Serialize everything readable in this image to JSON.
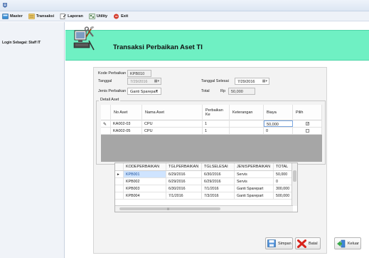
{
  "menu": {
    "items": [
      {
        "label": "Master",
        "icon": "master-icon",
        "color": "#3a8fd6"
      },
      {
        "label": "Transaksi",
        "icon": "transaksi-icon",
        "color": "#e2b23a"
      },
      {
        "label": "Laporan",
        "icon": "laporan-icon",
        "color": "#6a6a6a"
      },
      {
        "label": "Utility",
        "icon": "utility-icon",
        "color": "#4a7c4a"
      },
      {
        "label": "Exit",
        "icon": "exit-icon",
        "color": "#d43a2a"
      }
    ]
  },
  "sidebar": {
    "login_label": "Login Sebagai: Staff IT"
  },
  "header": {
    "title": "Transaksi Perbaikan Aset TI",
    "band_color": "#6ff0c3"
  },
  "form": {
    "kode_label": "Kode Perbaikan",
    "kode_value": "KPB010",
    "tanggal_label": "Tanggal",
    "tanggal_value": "7/29/2016",
    "jenis_label": "Jenis Perbaikan",
    "jenis_value": "Ganti Sparepart",
    "tgl_selesai_label": "Tanggal Selesai",
    "tgl_selesai_value": "7/29/2016",
    "total_label": "Total",
    "total_currency": "Rp",
    "total_value": "50,000"
  },
  "detail": {
    "legend": "Detail Aset",
    "columns": [
      "No Aset",
      "Nama Aset",
      "Perbaikan Ke",
      "Keterangan",
      "Biaya",
      "Pilih"
    ],
    "rows": [
      {
        "marker": "✎",
        "no": "KA002-03",
        "nama": "CPU",
        "ke": "1",
        "ket": "",
        "biaya": "50,000",
        "pilih": true
      },
      {
        "marker": "",
        "no": "KA002-05",
        "nama": "CPU",
        "ke": "1",
        "ket": "",
        "biaya": "0",
        "pilih": false
      }
    ]
  },
  "history": {
    "columns": [
      "KODEPERBAIKAN",
      "TGLPERBAIKAN",
      "TGLSELESAI",
      "JENISPERBAIKAN",
      "TOTAL"
    ],
    "rows": [
      {
        "marker": "▸",
        "kode": "KPB001",
        "tgl": "6/29/2016",
        "selesai": "6/30/2016",
        "jenis": "Servis",
        "total": "50,000"
      },
      {
        "marker": "",
        "kode": "KPB002",
        "tgl": "6/29/2016",
        "selesai": "6/29/2016",
        "jenis": "Servis",
        "total": "0"
      },
      {
        "marker": "",
        "kode": "KPB003",
        "tgl": "6/30/2016",
        "selesai": "7/1/2016",
        "jenis": "Ganti Sparepart",
        "total": "300,000"
      },
      {
        "marker": "",
        "kode": "KPB004",
        "tgl": "7/1/2016",
        "selesai": "7/3/2016",
        "jenis": "Ganti Sparepart",
        "total": "500,000"
      }
    ],
    "hscroll_mark": "|||"
  },
  "buttons": {
    "simpan": "Simpan",
    "batal": "Batal",
    "keluar": "Keluar"
  }
}
